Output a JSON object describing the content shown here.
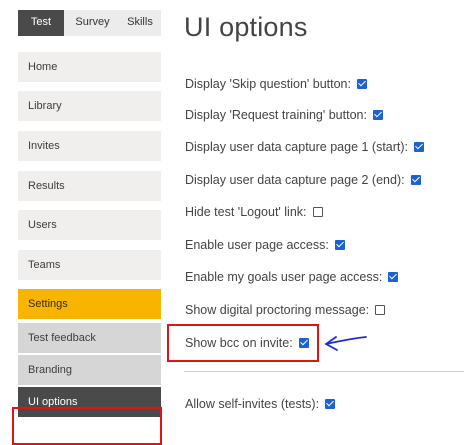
{
  "tabs": [
    {
      "label": "Test",
      "active": true
    },
    {
      "label": "Survey",
      "active": false
    },
    {
      "label": "Skills",
      "active": false
    }
  ],
  "nav": {
    "home": "Home",
    "library": "Library",
    "invites": "Invites",
    "results": "Results",
    "users": "Users",
    "teams": "Teams",
    "settings": "Settings",
    "test_feedback": "Test feedback",
    "branding": "Branding",
    "ui_options": "UI options"
  },
  "page_title": "UI options",
  "options": [
    {
      "label": "Display 'Skip question' button:",
      "checked": true
    },
    {
      "label": "Display 'Request training' button:",
      "checked": true
    },
    {
      "label": "Display user data capture page 1 (start):",
      "checked": true
    },
    {
      "label": "Display user data capture page 2 (end):",
      "checked": true
    },
    {
      "label": "Hide test 'Logout' link:",
      "checked": false
    },
    {
      "label": "Enable user page access:",
      "checked": true
    },
    {
      "label": "Enable my goals user page access:",
      "checked": true
    },
    {
      "label": "Show digital proctoring message:",
      "checked": false
    },
    {
      "label": "Show bcc on invite:",
      "checked": true
    },
    {
      "label": "Allow self-invites (tests):",
      "checked": true
    }
  ],
  "colors": {
    "accent": "#f7b500",
    "dark": "#4a4a4a",
    "checkbox": "#1a62d6",
    "annotation_red": "#e01414",
    "annotation_blue": "#1f2bd8"
  }
}
